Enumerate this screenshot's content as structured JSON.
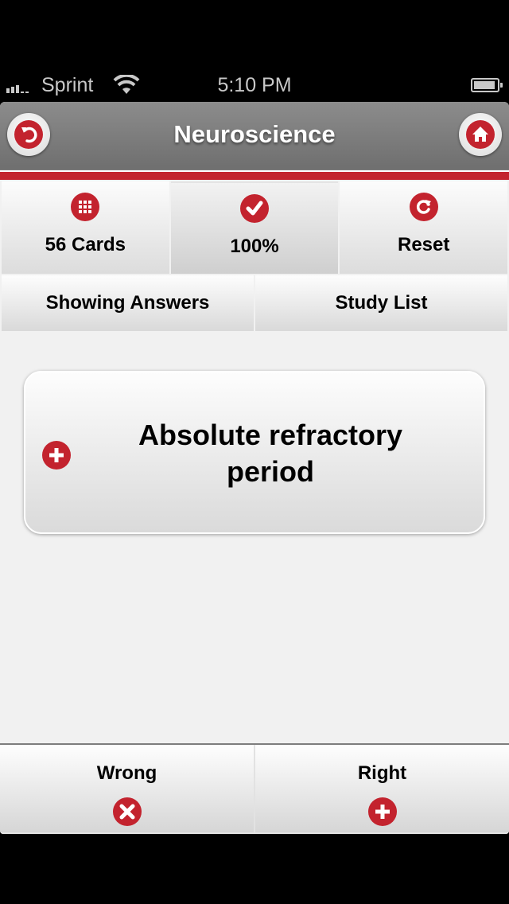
{
  "status_bar": {
    "carrier": "Sprint",
    "time": "5:10 PM",
    "signal_icon": "signal-bars-icon",
    "wifi_icon": "wifi-icon",
    "battery_icon": "battery-icon"
  },
  "nav": {
    "title": "Neuroscience",
    "back_icon": "undo-arrow-icon",
    "home_icon": "home-icon"
  },
  "toolbar": {
    "items": [
      {
        "label": "56 Cards",
        "icon": "grid-icon",
        "active": false
      },
      {
        "label": "100%",
        "icon": "checkmark-icon",
        "active": true
      },
      {
        "label": "Reset",
        "icon": "refresh-icon",
        "active": false
      }
    ]
  },
  "segments": {
    "items": [
      {
        "label": "Showing Answers"
      },
      {
        "label": "Study List"
      }
    ]
  },
  "card": {
    "term": "Absolute refractory period",
    "icon": "plus-icon"
  },
  "bottom": {
    "wrong_label": "Wrong",
    "wrong_icon": "x-icon",
    "right_label": "Right",
    "right_icon": "plus-icon"
  },
  "colors": {
    "accent": "#c3232e",
    "navbar": "#7f7f7f",
    "background": "#f1f1f1"
  }
}
